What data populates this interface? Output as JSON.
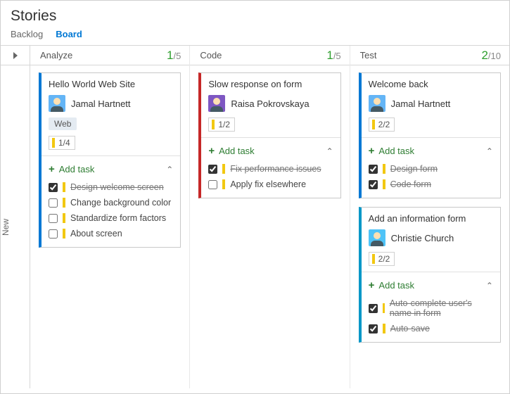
{
  "page": {
    "title": "Stories"
  },
  "tabs": {
    "backlog": "Backlog",
    "board": "Board",
    "active": "board"
  },
  "swimlane": {
    "label": "New"
  },
  "columns": [
    {
      "name": "Analyze",
      "count": 1,
      "limit": 5,
      "cards": [
        {
          "accent": "#0078d4",
          "title": "Hello World Web Site",
          "assignee": "Jamal Hartnett",
          "avatar": "a1",
          "tag": "Web",
          "progress": "1/4",
          "addTask": "Add task",
          "tasks": [
            {
              "done": true,
              "label": "Design welcome screen"
            },
            {
              "done": false,
              "label": "Change background color"
            },
            {
              "done": false,
              "label": "Standardize form factors"
            },
            {
              "done": false,
              "label": "About screen"
            }
          ]
        }
      ]
    },
    {
      "name": "Code",
      "count": 1,
      "limit": 5,
      "cards": [
        {
          "accent": "#c62828",
          "title": "Slow response on form",
          "assignee": "Raisa Pokrovskaya",
          "avatar": "a2",
          "tag": null,
          "progress": "1/2",
          "addTask": "Add task",
          "tasks": [
            {
              "done": true,
              "label": "Fix performance issues"
            },
            {
              "done": false,
              "label": "Apply fix elsewhere"
            }
          ]
        }
      ]
    },
    {
      "name": "Test",
      "count": 2,
      "limit": 10,
      "cards": [
        {
          "accent": "#0078d4",
          "title": "Welcome back",
          "assignee": "Jamal Hartnett",
          "avatar": "a1",
          "tag": null,
          "progress": "2/2",
          "addTask": "Add task",
          "tasks": [
            {
              "done": true,
              "label": "Design form"
            },
            {
              "done": true,
              "label": "Code form"
            }
          ]
        },
        {
          "accent": "#0097c7",
          "title": "Add an information form",
          "assignee": "Christie Church",
          "avatar": "a3",
          "tag": null,
          "progress": "2/2",
          "addTask": "Add task",
          "tasks": [
            {
              "done": true,
              "label": "Auto-complete user's name in form"
            },
            {
              "done": true,
              "label": "Auto-save"
            }
          ]
        }
      ]
    }
  ]
}
